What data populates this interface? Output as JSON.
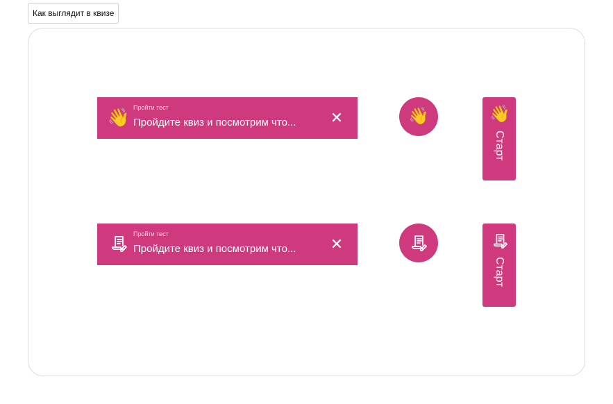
{
  "toolbar": {
    "preview_label": "Как выглядит в квизе"
  },
  "theme": {
    "accent": "#cf3a7f",
    "text": "#ffffff"
  },
  "variants": [
    {
      "icon": "waving-hand-icon",
      "emoji": "👋",
      "bar": {
        "subtitle": "Пройти тест",
        "title": "Пройдите квиз и посмотрим что...",
        "close_glyph": "✕"
      },
      "tab_label": "Старт"
    },
    {
      "icon": "document-edit-icon",
      "bar": {
        "subtitle": "Пройти тест",
        "title": "Пройдите квиз и посмотрим что...",
        "close_glyph": "✕"
      },
      "tab_label": "Старт"
    }
  ]
}
